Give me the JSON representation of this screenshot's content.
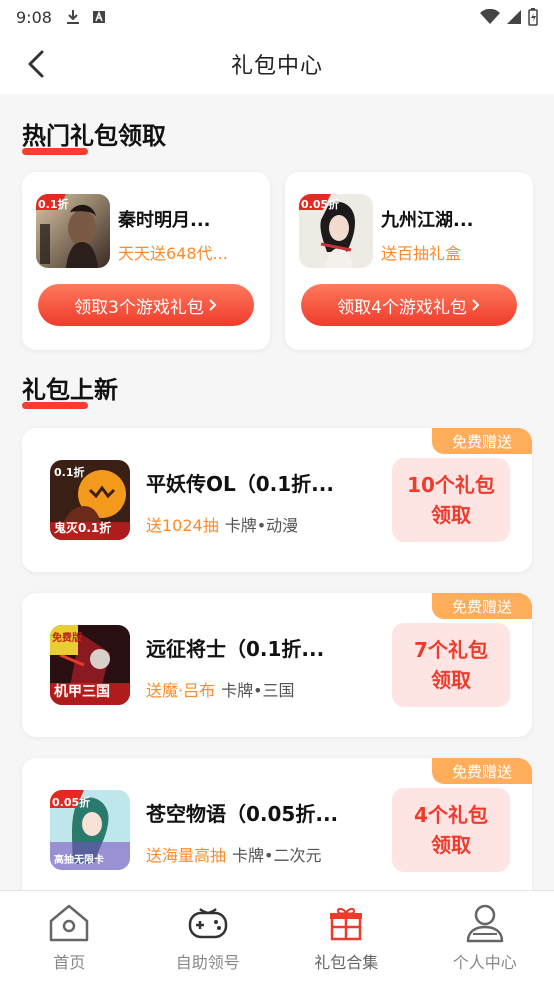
{
  "status": {
    "time": "9:08"
  },
  "nav": {
    "title": "礼包中心"
  },
  "hot_section": {
    "title": "热门礼包领取"
  },
  "hot_cards": [
    {
      "badge": "0.1折",
      "name": "秦时明月...",
      "gift": "天天送648代...",
      "button": "领取3个游戏礼包"
    },
    {
      "badge": "0.05折",
      "name": "九州江湖...",
      "gift": "送百抽礼盒",
      "button": "领取4个游戏礼包"
    }
  ],
  "new_section": {
    "title": "礼包上新"
  },
  "new_cards": [
    {
      "ribbon": "免费赠送",
      "badge": "0.1折",
      "thumb_caption": "鬼灭0.1折",
      "title": "平妖传OL（0.1折...",
      "highlight": "送1024抽",
      "tags": "卡牌•动漫",
      "pack_line1": "10个礼包",
      "pack_line2": "领取"
    },
    {
      "ribbon": "免费赠送",
      "badge": "免费版",
      "thumb_caption": "机甲三国",
      "title": "远征将士（0.1折...",
      "highlight": "送魔·吕布",
      "tags": "卡牌•三国",
      "pack_line1": "7个礼包",
      "pack_line2": "领取"
    },
    {
      "ribbon": "免费赠送",
      "badge": "0.05折",
      "thumb_caption": "高抽无限卡",
      "title": "苍空物语（0.05折...",
      "highlight": "送海量高抽",
      "tags": "卡牌•二次元",
      "pack_line1": "4个礼包",
      "pack_line2": "领取"
    }
  ],
  "tabs": [
    {
      "label": "首页",
      "icon": "home-icon"
    },
    {
      "label": "自助领号",
      "icon": "gamepad-icon"
    },
    {
      "label": "礼包合集",
      "icon": "gift-icon"
    },
    {
      "label": "个人中心",
      "icon": "user-icon"
    }
  ],
  "colors": {
    "accent": "#ef3b2c",
    "orange": "#ff8a2a",
    "ribbon": "#ffad5a",
    "pack_bg": "#ffe4e4"
  }
}
